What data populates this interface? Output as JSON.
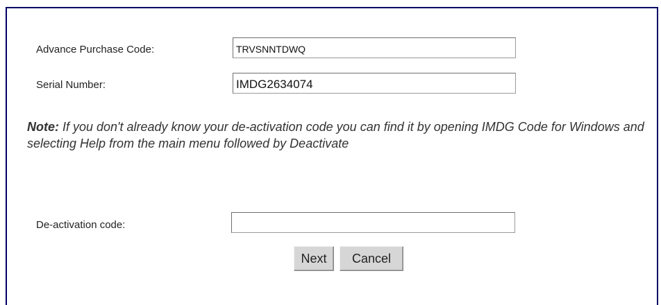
{
  "form": {
    "advance_purchase_code": {
      "label": "Advance Purchase Code:",
      "value": "TRVSNNTDWQ"
    },
    "serial_number": {
      "label": "Serial Number:",
      "value": "IMDG2634074"
    },
    "note": {
      "prefix": "Note:",
      "text": " If you don't already know your de-activation code you can find it by opening IMDG Code for Windows and selecting Help from the main menu followed by Deactivate"
    },
    "deactivation_code": {
      "label": "De-activation code:",
      "value": ""
    },
    "buttons": {
      "next": "Next",
      "cancel": "Cancel"
    }
  },
  "colors": {
    "panel_border": "#000066",
    "button_face": "#d6d6d6"
  }
}
